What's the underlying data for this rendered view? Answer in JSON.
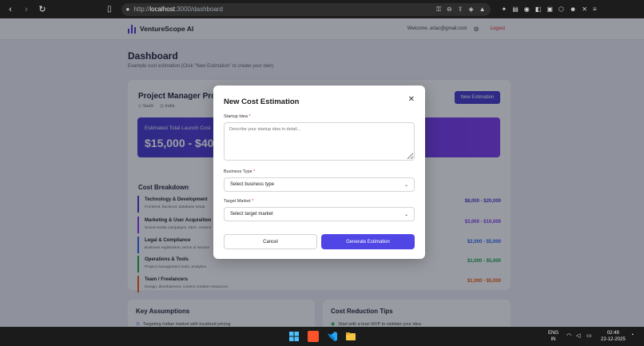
{
  "browser": {
    "url_scheme": "http://",
    "url_host": "localhost",
    "url_path": ":3000/dashboard"
  },
  "nav": {
    "brand": "VentureScope AI",
    "welcome": "Welcome, ariac@gmail.com",
    "logout": "Logout"
  },
  "dashboard": {
    "title": "Dashboard",
    "subtitle": "Example cost estimation (Click \"New Estimation\" to create your own)"
  },
  "project": {
    "title": "Project Manager Pro",
    "meta_type": "SaaS",
    "meta_market": "India",
    "new_estimation_label": "New Estimation",
    "estimate_label": "Estimated Total Launch Cost",
    "estimate_value": "$15,000 - $40,000"
  },
  "cost_breakdown": {
    "title": "Cost Breakdown",
    "items": [
      {
        "name": "Technology & Development",
        "desc": "Frontend, backend, database setup",
        "amount": "$8,000 - $20,000",
        "color": "#4338ca"
      },
      {
        "name": "Marketing & User Acquisition",
        "desc": "Social media campaigns, SEO, content",
        "amount": "$3,000 - $10,000",
        "color": "#7c3aed"
      },
      {
        "name": "Legal & Compliance",
        "desc": "Business registration, terms of service",
        "amount": "$2,000 - $5,000",
        "color": "#2563eb"
      },
      {
        "name": "Operations & Tools",
        "desc": "Project management tools, analytics",
        "amount": "$1,000 - $5,000",
        "color": "#16a34a"
      },
      {
        "name": "Team / Freelancers",
        "desc": "Design, development, content creation resources",
        "amount": "$1,000 - $5,000",
        "color": "#ea580c"
      }
    ]
  },
  "key_assumptions": {
    "title": "Key Assumptions",
    "first_item": "Targeting Indian market with localized pricing"
  },
  "cost_reduction": {
    "title": "Cost Reduction Tips",
    "first_item": "Start with a lean MVP to validate your idea"
  },
  "modal": {
    "title": "New Cost Estimation",
    "close_icon": "close-icon",
    "startup_label": "Startup Idea",
    "startup_placeholder": "Describe your startup idea in detail...",
    "business_label": "Business Type",
    "business_value": "Select business type",
    "market_label": "Target Market",
    "market_value": "Select target market",
    "cancel_label": "Cancel",
    "generate_label": "Generate Estimation",
    "required_mark": "*"
  },
  "taskbar": {
    "lang_top": "ENG",
    "lang_bottom": "IN",
    "time": "02:49",
    "date": "22-12-2025"
  },
  "colors": {
    "accent": "#4f46e5",
    "brand": "#4338ca"
  }
}
